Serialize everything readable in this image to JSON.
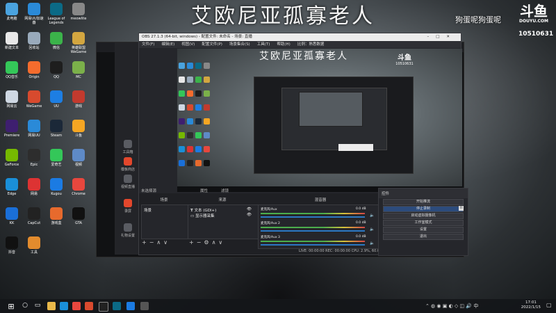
{
  "wallpaper": {
    "title": "艾欧尼亚孤寡老人",
    "streamer_name": "狗蛋呢狗蛋呢",
    "logo_main": "斗鱼",
    "logo_sub": "DOUYU.COM",
    "room_id": "10510631"
  },
  "desktop_icons": [
    {
      "label": "此电脑",
      "color": "#4aa3df"
    },
    {
      "label": "网易UU加速器",
      "color": "#2a8ad8"
    },
    {
      "label": "League of Legends",
      "color": "#0b6a86"
    },
    {
      "label": "meowlite",
      "color": "#888"
    },
    {
      "label": "新建文本",
      "color": "#e8e8e8"
    },
    {
      "label": "回收站",
      "color": "#9ab"
    },
    {
      "label": "微信",
      "color": "#3bb34a"
    },
    {
      "label": "英雄联盟WeGame",
      "color": "#d3a640"
    },
    {
      "label": "QQ音乐",
      "color": "#34c759"
    },
    {
      "label": "Origin",
      "color": "#f56c2d"
    },
    {
      "label": "QQ",
      "color": "#1e1e1e"
    },
    {
      "label": "MC",
      "color": "#7bb04a"
    },
    {
      "label": "网易云",
      "color": "#cfd8e3"
    },
    {
      "label": "WeGame",
      "color": "#d84a2e"
    },
    {
      "label": "UU",
      "color": "#1d7ee3"
    },
    {
      "label": "游戏",
      "color": "#c23a2e"
    },
    {
      "label": "Premiere",
      "color": "#3e1f6f"
    },
    {
      "label": "网易UU",
      "color": "#2a8ad8"
    },
    {
      "label": "Steam",
      "color": "#1b2838"
    },
    {
      "label": "斗鱼",
      "color": "#f5a623"
    },
    {
      "label": "GeForce",
      "color": "#76b900"
    },
    {
      "label": "Epic",
      "color": "#2d2d2d"
    },
    {
      "label": "爱奇艺",
      "color": "#34c759"
    },
    {
      "label": "视频",
      "color": "#5e8ac7"
    },
    {
      "label": "Edge",
      "color": "#1a8fd8"
    },
    {
      "label": "网易",
      "color": "#d33"
    },
    {
      "label": "Kugou",
      "color": "#1b7be3"
    },
    {
      "label": "Chrome",
      "color": "#e8473e"
    },
    {
      "label": "KK",
      "color": "#1a6fd8"
    },
    {
      "label": "CapCut",
      "color": "#222"
    },
    {
      "label": "游戏盒",
      "color": "#e76a2d"
    },
    {
      "label": "GTA",
      "color": "#111"
    },
    {
      "label": "抖音",
      "color": "#111"
    },
    {
      "label": "工具",
      "color": "#e28b2d"
    }
  ],
  "obs": {
    "title": "OBS 27.1.3 (64-bit, windows) - 配置文件: 未命名 - 场景: 直播",
    "menu": [
      "文件(F)",
      "编辑(E)",
      "视图(V)",
      "配置文件(P)",
      "场景集合(S)",
      "工具(T)",
      "帮助(H)",
      "比例：熟悉数据"
    ],
    "preview_title": "艾欧尼亚孤寡老人",
    "preview_logo": "斗鱼",
    "preview_room": "10510631",
    "docks": {
      "scene_filter_label": "未选择源",
      "props_label": "属性",
      "filters_label": "滤镜",
      "scenes_head": "场景",
      "sources_head": "来源",
      "mixer_head": "混音器",
      "scene_items": [
        "场景"
      ],
      "source_items": [
        "文本 (GDI+)",
        "显示器采集"
      ],
      "mixer_tracks": [
        {
          "name": "麦克风/Aux",
          "db": "0.0 dB"
        },
        {
          "name": "麦克风/Aux 2",
          "db": "0.0 dB"
        },
        {
          "name": "麦克风/Aux 3",
          "db": "0.0 dB"
        }
      ],
      "status": "LIVE: 00:00:00   REC: 00:00:00   CPU: 2.9%, 60.00 fps"
    },
    "controls": {
      "head": "控件",
      "buttons": [
        "开始推流",
        "停止录制",
        "启动虚拟摄像机",
        "工作室模式",
        "设置",
        "退出"
      ],
      "active_index": 1
    }
  },
  "douyu_panel": {
    "items": [
      "工具箱",
      "模板商店",
      "视频直播",
      "录屏",
      "礼物设置"
    ],
    "badges": [
      "新"
    ]
  },
  "taskbar": {
    "time": "17:01",
    "date": "2022/1/15"
  }
}
